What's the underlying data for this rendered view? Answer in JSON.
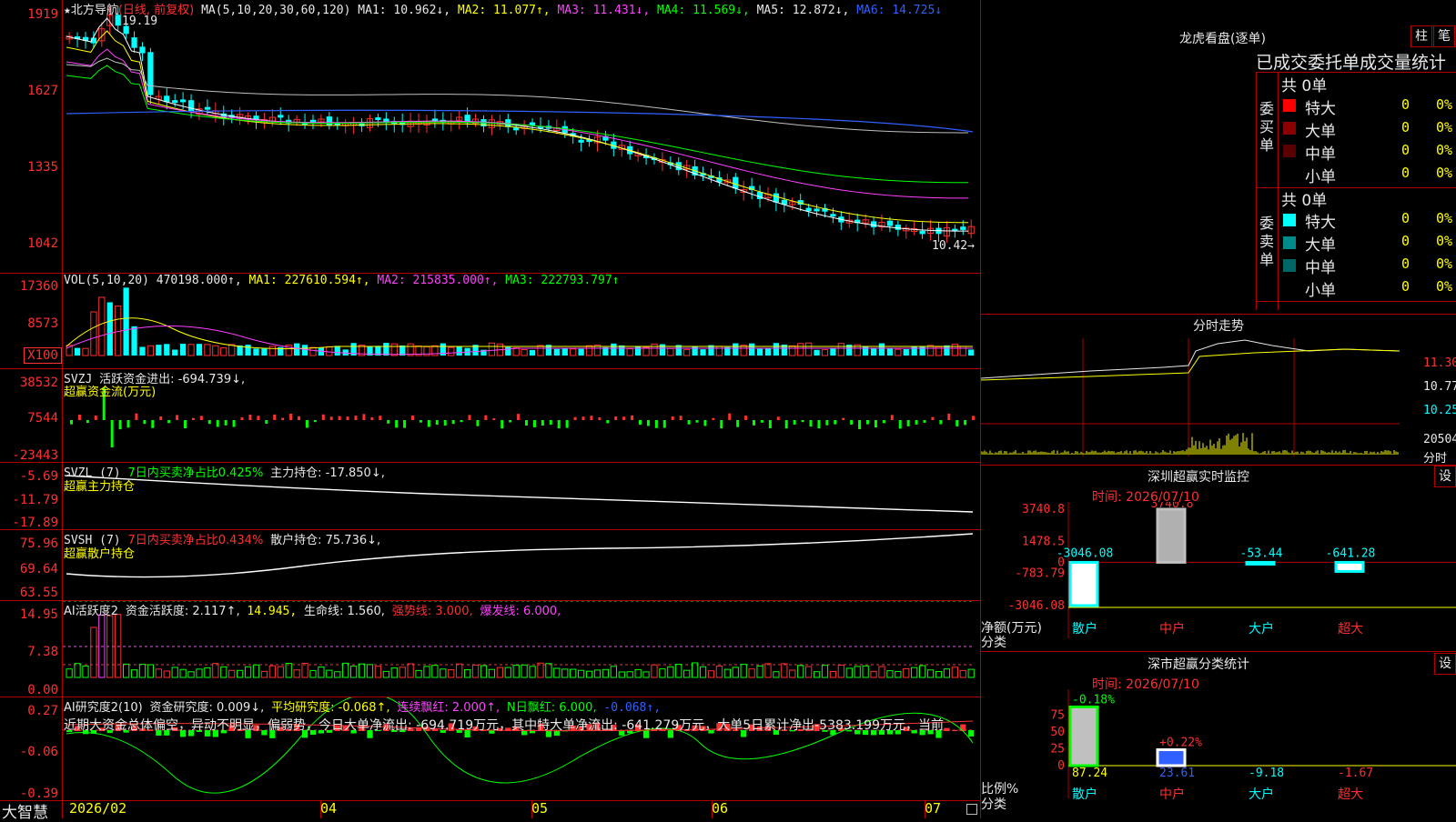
{
  "colors": {
    "up": "#ff3030",
    "down": "#00ffff",
    "grid": "#b00000",
    "ma1": "#ffffff",
    "ma2": "#ffff00",
    "ma3": "#ff40ff",
    "ma4": "#00ff00",
    "ma5": "#c0c0c0",
    "ma6": "#3060ff"
  },
  "main": {
    "star": "★",
    "stock_name": "北方导航",
    "period": "(日线, 前复权)",
    "ma_params": "MA(5,10,20,30,60,120)",
    "ma1": "MA1: 10.962↓,",
    "ma2": "MA2: 11.077↑,",
    "ma3": "MA3: 11.431↓,",
    "ma4": "MA4: 11.569↓,",
    "ma5": "MA5: 12.872↓,",
    "ma6": "MA6: 14.725↓",
    "high_label": "19.19",
    "low_label": "10.42→",
    "y_ticks": [
      "1919",
      "1627",
      "1335",
      "1042"
    ]
  },
  "vol": {
    "name": "VOL(5,10,20)",
    "value": "470198.000↑,",
    "ma1": "MA1: 227610.594↑,",
    "ma2": "MA2: 215835.000↑,",
    "ma3": "MA3: 222793.797↑",
    "y_ticks": [
      "17360",
      "8573",
      "X100"
    ]
  },
  "svzj": {
    "name": "SVZJ",
    "label": "活跃资金进出: -694.739↓,",
    "sub": "超赢资金流(万元)",
    "y_ticks": [
      "38532",
      "7544",
      "-23443"
    ]
  },
  "svzl": {
    "name": "SVZL (7)",
    "ratio": "7日内买卖净占比0.425%",
    "hold": "主力持仓: -17.850↓,",
    "sub": "超赢主力持仓",
    "y_ticks": [
      "-5.69",
      "-11.79",
      "-17.89"
    ]
  },
  "svsh": {
    "name": "SVSH (7)",
    "ratio": "7日内买卖净占比0.434%",
    "hold": "散户持仓: 75.736↓,",
    "sub": "超赢散户持仓",
    "y_ticks": [
      "75.96",
      "69.64",
      "63.55"
    ]
  },
  "ai1": {
    "name": "AI活跃度2",
    "active": "资金活跃度: 2.117↑,",
    "v2": "14.945,",
    "life": "生命线: 1.560,",
    "strong": "强势线: 3.000,",
    "burst": "爆发线: 6.000,",
    "y_ticks": [
      "14.95",
      "7.38",
      "0.00"
    ]
  },
  "ai2": {
    "name": "AI研究度2(10)",
    "research": "资金研究度: 0.009↓,",
    "avg": "平均研究度: -0.068↑,",
    "red": "连续飘红: 2.000↑,",
    "nred": "N日飘红: 6.000,",
    "extra": "-0.068↑,",
    "comment": "近期大资金总体偏空，异动不明显，偏弱势，今日大单净流出: -694.719万元，其中特大单净流出: -641.279万元，大单5日累计净出-5383.199万元，当前",
    "y_ticks": [
      "0.27",
      "-0.06",
      "-0.39"
    ]
  },
  "xaxis": {
    "app": "大智慧",
    "labels": [
      "2026/02",
      "04",
      "05",
      "06",
      "07"
    ]
  },
  "right": {
    "lhb_title": "龙虎看盘(逐单)",
    "btn_bar": "柱",
    "btn_pen": "笔",
    "order_stats": "已成交委托单成交量统计",
    "buy_label": "委买单",
    "sell_label": "委卖单",
    "buy_total": "共 0单",
    "sell_total": "共 0单",
    "levels": [
      {
        "name": "特大",
        "count": "0",
        "pct": "0%"
      },
      {
        "name": "大单",
        "count": "0",
        "pct": "0%"
      },
      {
        "name": "中单",
        "count": "0",
        "pct": "0%"
      },
      {
        "name": "小单",
        "count": "0",
        "pct": "0%"
      }
    ],
    "intraday_title": "分时走势",
    "intraday_ticks": [
      "11.30",
      "10.77",
      "10.25",
      "20504",
      "分时"
    ],
    "monitor_title": "深圳超赢实时监控",
    "btn_set": "设",
    "time_label": "时间: 2026/07/10",
    "net_label": "净额(万元)",
    "cat_label": "分类",
    "ratio_label": "比例%",
    "stats_title": "深市超赢分类统计",
    "categories": [
      "散户",
      "中户",
      "大户",
      "超大"
    ]
  },
  "chart_data": [
    {
      "type": "bar",
      "title": "深圳超赢实时监控",
      "ylabel": "净额(万元)",
      "categories": [
        "散户",
        "中户",
        "大户",
        "超大"
      ],
      "values": [
        -3046.08,
        3740.8,
        -53.44,
        -641.28
      ],
      "y_ticks": [
        3740.8,
        1478.5,
        0,
        -783.79,
        -3046.08
      ],
      "ylim": [
        -3046.08,
        3740.8
      ]
    },
    {
      "type": "bar",
      "title": "深市超赢分类统计",
      "ylabel": "比例%",
      "categories": [
        "散户",
        "中户",
        "大户",
        "超大"
      ],
      "values": [
        87.24,
        23.61,
        -9.18,
        -1.67
      ],
      "changes": [
        "-0.18%",
        "+0.22%",
        "",
        ""
      ],
      "y_ticks": [
        75,
        50,
        25,
        0
      ],
      "ylim": [
        0,
        100
      ]
    }
  ]
}
